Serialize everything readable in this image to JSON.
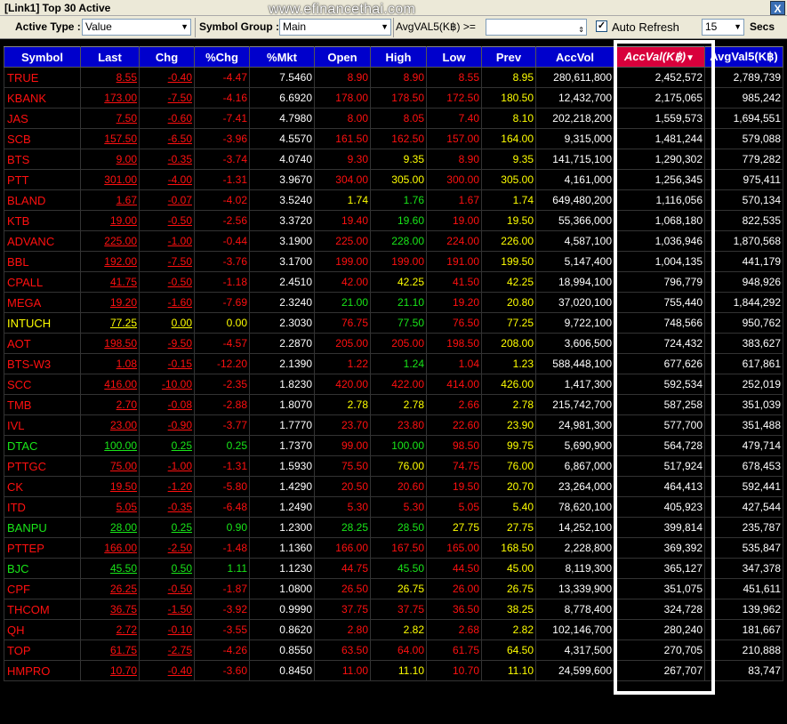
{
  "window": {
    "title": "[Link1] Top 30 Active",
    "watermark": "www.efinancethai.com",
    "close_label": "X"
  },
  "toolbar": {
    "active_type_label": "Active Type :",
    "active_type_value": "Value",
    "symbol_group_label": "Symbol Group :",
    "symbol_group_value": "Main",
    "avgval_label": "AvgVAL5(K฿) >=",
    "auto_refresh_label": "Auto Refresh",
    "auto_refresh_checked": true,
    "interval_value": "15",
    "secs_label": "Secs"
  },
  "columns": [
    "Symbol",
    "Last",
    "Chg",
    "%Chg",
    "%Mkt",
    "Open",
    "High",
    "Low",
    "Prev",
    "AccVol",
    "AccVal(K฿)",
    "AvgVal5(K฿)"
  ],
  "sorted_column": 10,
  "colors": {
    "up": "#19e619",
    "down": "#ff1010",
    "unchanged": "#ffff00",
    "header": "#0000cc",
    "sorted_header": "#d8003c"
  },
  "rows": [
    {
      "sym": "TRUE",
      "last": "8.55",
      "chg": "-0.40",
      "pchg": "-4.47",
      "pmkt": "7.5460",
      "open": "8.90",
      "high": "8.90",
      "low": "8.55",
      "prev": "8.95",
      "accvol": "280,611,800",
      "accval": "2,452,572",
      "avgval5": "2,789,739",
      "c": "dn",
      "co": "dn",
      "ch": "dn",
      "cl": "dn"
    },
    {
      "sym": "KBANK",
      "last": "173.00",
      "chg": "-7.50",
      "pchg": "-4.16",
      "pmkt": "6.6920",
      "open": "178.00",
      "high": "178.50",
      "low": "172.50",
      "prev": "180.50",
      "accvol": "12,432,700",
      "accval": "2,175,065",
      "avgval5": "985,242",
      "c": "dn",
      "co": "dn",
      "ch": "dn",
      "cl": "dn"
    },
    {
      "sym": "JAS",
      "last": "7.50",
      "chg": "-0.60",
      "pchg": "-7.41",
      "pmkt": "4.7980",
      "open": "8.00",
      "high": "8.05",
      "low": "7.40",
      "prev": "8.10",
      "accvol": "202,218,200",
      "accval": "1,559,573",
      "avgval5": "1,694,551",
      "c": "dn",
      "co": "dn",
      "ch": "dn",
      "cl": "dn"
    },
    {
      "sym": "SCB",
      "last": "157.50",
      "chg": "-6.50",
      "pchg": "-3.96",
      "pmkt": "4.5570",
      "open": "161.50",
      "high": "162.50",
      "low": "157.00",
      "prev": "164.00",
      "accvol": "9,315,000",
      "accval": "1,481,244",
      "avgval5": "579,088",
      "c": "dn",
      "co": "dn",
      "ch": "dn",
      "cl": "dn"
    },
    {
      "sym": "BTS",
      "last": "9.00",
      "chg": "-0.35",
      "pchg": "-3.74",
      "pmkt": "4.0740",
      "open": "9.30",
      "high": "9.35",
      "low": "8.90",
      "prev": "9.35",
      "accvol": "141,715,100",
      "accval": "1,290,302",
      "avgval5": "779,282",
      "c": "dn",
      "co": "dn",
      "ch": "eq",
      "cl": "dn"
    },
    {
      "sym": "PTT",
      "last": "301.00",
      "chg": "-4.00",
      "pchg": "-1.31",
      "pmkt": "3.9670",
      "open": "304.00",
      "high": "305.00",
      "low": "300.00",
      "prev": "305.00",
      "accvol": "4,161,000",
      "accval": "1,256,345",
      "avgval5": "975,411",
      "c": "dn",
      "co": "dn",
      "ch": "eq",
      "cl": "dn"
    },
    {
      "sym": "BLAND",
      "last": "1.67",
      "chg": "-0.07",
      "pchg": "-4.02",
      "pmkt": "3.5240",
      "open": "1.74",
      "high": "1.76",
      "low": "1.67",
      "prev": "1.74",
      "accvol": "649,480,200",
      "accval": "1,116,056",
      "avgval5": "570,134",
      "c": "dn",
      "co": "eq",
      "ch": "up",
      "cl": "dn"
    },
    {
      "sym": "KTB",
      "last": "19.00",
      "chg": "-0.50",
      "pchg": "-2.56",
      "pmkt": "3.3720",
      "open": "19.40",
      "high": "19.60",
      "low": "19.00",
      "prev": "19.50",
      "accvol": "55,366,000",
      "accval": "1,068,180",
      "avgval5": "822,535",
      "c": "dn",
      "co": "dn",
      "ch": "up",
      "cl": "dn"
    },
    {
      "sym": "ADVANC",
      "last": "225.00",
      "chg": "-1.00",
      "pchg": "-0.44",
      "pmkt": "3.1900",
      "open": "225.00",
      "high": "228.00",
      "low": "224.00",
      "prev": "226.00",
      "accvol": "4,587,100",
      "accval": "1,036,946",
      "avgval5": "1,870,568",
      "c": "dn",
      "co": "dn",
      "ch": "up",
      "cl": "dn"
    },
    {
      "sym": "BBL",
      "last": "192.00",
      "chg": "-7.50",
      "pchg": "-3.76",
      "pmkt": "3.1700",
      "open": "199.00",
      "high": "199.00",
      "low": "191.00",
      "prev": "199.50",
      "accvol": "5,147,400",
      "accval": "1,004,135",
      "avgval5": "441,179",
      "c": "dn",
      "co": "dn",
      "ch": "dn",
      "cl": "dn"
    },
    {
      "sym": "CPALL",
      "last": "41.75",
      "chg": "-0.50",
      "pchg": "-1.18",
      "pmkt": "2.4510",
      "open": "42.00",
      "high": "42.25",
      "low": "41.50",
      "prev": "42.25",
      "accvol": "18,994,100",
      "accval": "796,779",
      "avgval5": "948,926",
      "c": "dn",
      "co": "dn",
      "ch": "eq",
      "cl": "dn"
    },
    {
      "sym": "MEGA",
      "last": "19.20",
      "chg": "-1.60",
      "pchg": "-7.69",
      "pmkt": "2.3240",
      "open": "21.00",
      "high": "21.10",
      "low": "19.20",
      "prev": "20.80",
      "accvol": "37,020,100",
      "accval": "755,440",
      "avgval5": "1,844,292",
      "c": "dn",
      "co": "up",
      "ch": "up",
      "cl": "dn"
    },
    {
      "sym": "INTUCH",
      "last": "77.25",
      "chg": "0.00",
      "pchg": "0.00",
      "pmkt": "2.3030",
      "open": "76.75",
      "high": "77.50",
      "low": "76.50",
      "prev": "77.25",
      "accvol": "9,722,100",
      "accval": "748,566",
      "avgval5": "950,762",
      "c": "eq",
      "co": "dn",
      "ch": "up",
      "cl": "dn"
    },
    {
      "sym": "AOT",
      "last": "198.50",
      "chg": "-9.50",
      "pchg": "-4.57",
      "pmkt": "2.2870",
      "open": "205.00",
      "high": "205.00",
      "low": "198.50",
      "prev": "208.00",
      "accvol": "3,606,500",
      "accval": "724,432",
      "avgval5": "383,627",
      "c": "dn",
      "co": "dn",
      "ch": "dn",
      "cl": "dn"
    },
    {
      "sym": "BTS-W3",
      "last": "1.08",
      "chg": "-0.15",
      "pchg": "-12.20",
      "pmkt": "2.1390",
      "open": "1.22",
      "high": "1.24",
      "low": "1.04",
      "prev": "1.23",
      "accvol": "588,448,100",
      "accval": "677,626",
      "avgval5": "617,861",
      "c": "dn",
      "co": "dn",
      "ch": "up",
      "cl": "dn"
    },
    {
      "sym": "SCC",
      "last": "416.00",
      "chg": "-10.00",
      "pchg": "-2.35",
      "pmkt": "1.8230",
      "open": "420.00",
      "high": "422.00",
      "low": "414.00",
      "prev": "426.00",
      "accvol": "1,417,300",
      "accval": "592,534",
      "avgval5": "252,019",
      "c": "dn",
      "co": "dn",
      "ch": "dn",
      "cl": "dn"
    },
    {
      "sym": "TMB",
      "last": "2.70",
      "chg": "-0.08",
      "pchg": "-2.88",
      "pmkt": "1.8070",
      "open": "2.78",
      "high": "2.78",
      "low": "2.66",
      "prev": "2.78",
      "accvol": "215,742,700",
      "accval": "587,258",
      "avgval5": "351,039",
      "c": "dn",
      "co": "eq",
      "ch": "eq",
      "cl": "dn"
    },
    {
      "sym": "IVL",
      "last": "23.00",
      "chg": "-0.90",
      "pchg": "-3.77",
      "pmkt": "1.7770",
      "open": "23.70",
      "high": "23.80",
      "low": "22.60",
      "prev": "23.90",
      "accvol": "24,981,300",
      "accval": "577,700",
      "avgval5": "351,488",
      "c": "dn",
      "co": "dn",
      "ch": "dn",
      "cl": "dn"
    },
    {
      "sym": "DTAC",
      "last": "100.00",
      "chg": "0.25",
      "pchg": "0.25",
      "pmkt": "1.7370",
      "open": "99.00",
      "high": "100.00",
      "low": "98.50",
      "prev": "99.75",
      "accvol": "5,690,900",
      "accval": "564,728",
      "avgval5": "479,714",
      "c": "up",
      "co": "dn",
      "ch": "up",
      "cl": "dn"
    },
    {
      "sym": "PTTGC",
      "last": "75.00",
      "chg": "-1.00",
      "pchg": "-1.31",
      "pmkt": "1.5930",
      "open": "75.50",
      "high": "76.00",
      "low": "74.75",
      "prev": "76.00",
      "accvol": "6,867,000",
      "accval": "517,924",
      "avgval5": "678,453",
      "c": "dn",
      "co": "dn",
      "ch": "eq",
      "cl": "dn"
    },
    {
      "sym": "CK",
      "last": "19.50",
      "chg": "-1.20",
      "pchg": "-5.80",
      "pmkt": "1.4290",
      "open": "20.50",
      "high": "20.60",
      "low": "19.50",
      "prev": "20.70",
      "accvol": "23,264,000",
      "accval": "464,413",
      "avgval5": "592,441",
      "c": "dn",
      "co": "dn",
      "ch": "dn",
      "cl": "dn"
    },
    {
      "sym": "ITD",
      "last": "5.05",
      "chg": "-0.35",
      "pchg": "-6.48",
      "pmkt": "1.2490",
      "open": "5.30",
      "high": "5.30",
      "low": "5.05",
      "prev": "5.40",
      "accvol": "78,620,100",
      "accval": "405,923",
      "avgval5": "427,544",
      "c": "dn",
      "co": "dn",
      "ch": "dn",
      "cl": "dn"
    },
    {
      "sym": "BANPU",
      "last": "28.00",
      "chg": "0.25",
      "pchg": "0.90",
      "pmkt": "1.2300",
      "open": "28.25",
      "high": "28.50",
      "low": "27.75",
      "prev": "27.75",
      "accvol": "14,252,100",
      "accval": "399,814",
      "avgval5": "235,787",
      "c": "up",
      "co": "up",
      "ch": "up",
      "cl": "eq"
    },
    {
      "sym": "PTTEP",
      "last": "166.00",
      "chg": "-2.50",
      "pchg": "-1.48",
      "pmkt": "1.1360",
      "open": "166.00",
      "high": "167.50",
      "low": "165.00",
      "prev": "168.50",
      "accvol": "2,228,800",
      "accval": "369,392",
      "avgval5": "535,847",
      "c": "dn",
      "co": "dn",
      "ch": "dn",
      "cl": "dn"
    },
    {
      "sym": "BJC",
      "last": "45.50",
      "chg": "0.50",
      "pchg": "1.11",
      "pmkt": "1.1230",
      "open": "44.75",
      "high": "45.50",
      "low": "44.50",
      "prev": "45.00",
      "accvol": "8,119,300",
      "accval": "365,127",
      "avgval5": "347,378",
      "c": "up",
      "co": "dn",
      "ch": "up",
      "cl": "dn"
    },
    {
      "sym": "CPF",
      "last": "26.25",
      "chg": "-0.50",
      "pchg": "-1.87",
      "pmkt": "1.0800",
      "open": "26.50",
      "high": "26.75",
      "low": "26.00",
      "prev": "26.75",
      "accvol": "13,339,900",
      "accval": "351,075",
      "avgval5": "451,611",
      "c": "dn",
      "co": "dn",
      "ch": "eq",
      "cl": "dn"
    },
    {
      "sym": "THCOM",
      "last": "36.75",
      "chg": "-1.50",
      "pchg": "-3.92",
      "pmkt": "0.9990",
      "open": "37.75",
      "high": "37.75",
      "low": "36.50",
      "prev": "38.25",
      "accvol": "8,778,400",
      "accval": "324,728",
      "avgval5": "139,962",
      "c": "dn",
      "co": "dn",
      "ch": "dn",
      "cl": "dn"
    },
    {
      "sym": "QH",
      "last": "2.72",
      "chg": "-0.10",
      "pchg": "-3.55",
      "pmkt": "0.8620",
      "open": "2.80",
      "high": "2.82",
      "low": "2.68",
      "prev": "2.82",
      "accvol": "102,146,700",
      "accval": "280,240",
      "avgval5": "181,667",
      "c": "dn",
      "co": "dn",
      "ch": "eq",
      "cl": "dn"
    },
    {
      "sym": "TOP",
      "last": "61.75",
      "chg": "-2.75",
      "pchg": "-4.26",
      "pmkt": "0.8550",
      "open": "63.50",
      "high": "64.00",
      "low": "61.75",
      "prev": "64.50",
      "accvol": "4,317,500",
      "accval": "270,705",
      "avgval5": "210,888",
      "c": "dn",
      "co": "dn",
      "ch": "dn",
      "cl": "dn"
    },
    {
      "sym": "HMPRO",
      "last": "10.70",
      "chg": "-0.40",
      "pchg": "-3.60",
      "pmkt": "0.8450",
      "open": "11.00",
      "high": "11.10",
      "low": "10.70",
      "prev": "11.10",
      "accvol": "24,599,600",
      "accval": "267,707",
      "avgval5": "83,747",
      "c": "dn",
      "co": "dn",
      "ch": "eq",
      "cl": "dn"
    }
  ]
}
